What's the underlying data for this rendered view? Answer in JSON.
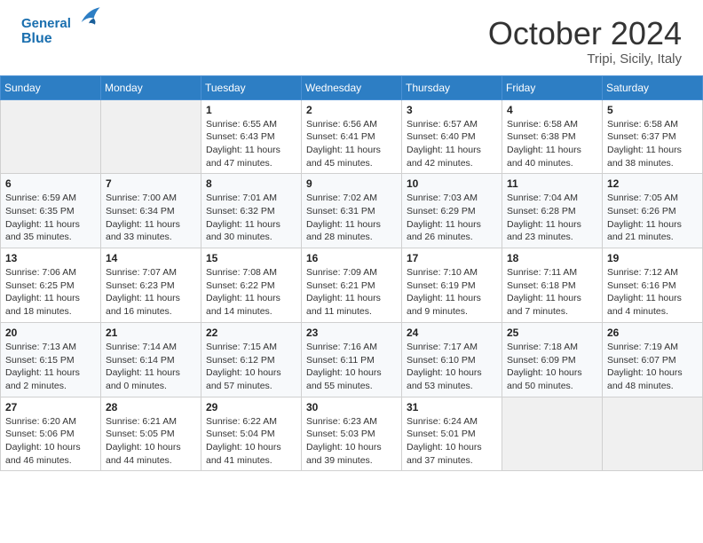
{
  "header": {
    "logo_line1": "General",
    "logo_line2": "Blue",
    "month_title": "October 2024",
    "location": "Tripi, Sicily, Italy"
  },
  "weekdays": [
    "Sunday",
    "Monday",
    "Tuesday",
    "Wednesday",
    "Thursday",
    "Friday",
    "Saturday"
  ],
  "weeks": [
    [
      {
        "day": "",
        "info": ""
      },
      {
        "day": "",
        "info": ""
      },
      {
        "day": "1",
        "info": "Sunrise: 6:55 AM\nSunset: 6:43 PM\nDaylight: 11 hours and 47 minutes."
      },
      {
        "day": "2",
        "info": "Sunrise: 6:56 AM\nSunset: 6:41 PM\nDaylight: 11 hours and 45 minutes."
      },
      {
        "day": "3",
        "info": "Sunrise: 6:57 AM\nSunset: 6:40 PM\nDaylight: 11 hours and 42 minutes."
      },
      {
        "day": "4",
        "info": "Sunrise: 6:58 AM\nSunset: 6:38 PM\nDaylight: 11 hours and 40 minutes."
      },
      {
        "day": "5",
        "info": "Sunrise: 6:58 AM\nSunset: 6:37 PM\nDaylight: 11 hours and 38 minutes."
      }
    ],
    [
      {
        "day": "6",
        "info": "Sunrise: 6:59 AM\nSunset: 6:35 PM\nDaylight: 11 hours and 35 minutes."
      },
      {
        "day": "7",
        "info": "Sunrise: 7:00 AM\nSunset: 6:34 PM\nDaylight: 11 hours and 33 minutes."
      },
      {
        "day": "8",
        "info": "Sunrise: 7:01 AM\nSunset: 6:32 PM\nDaylight: 11 hours and 30 minutes."
      },
      {
        "day": "9",
        "info": "Sunrise: 7:02 AM\nSunset: 6:31 PM\nDaylight: 11 hours and 28 minutes."
      },
      {
        "day": "10",
        "info": "Sunrise: 7:03 AM\nSunset: 6:29 PM\nDaylight: 11 hours and 26 minutes."
      },
      {
        "day": "11",
        "info": "Sunrise: 7:04 AM\nSunset: 6:28 PM\nDaylight: 11 hours and 23 minutes."
      },
      {
        "day": "12",
        "info": "Sunrise: 7:05 AM\nSunset: 6:26 PM\nDaylight: 11 hours and 21 minutes."
      }
    ],
    [
      {
        "day": "13",
        "info": "Sunrise: 7:06 AM\nSunset: 6:25 PM\nDaylight: 11 hours and 18 minutes."
      },
      {
        "day": "14",
        "info": "Sunrise: 7:07 AM\nSunset: 6:23 PM\nDaylight: 11 hours and 16 minutes."
      },
      {
        "day": "15",
        "info": "Sunrise: 7:08 AM\nSunset: 6:22 PM\nDaylight: 11 hours and 14 minutes."
      },
      {
        "day": "16",
        "info": "Sunrise: 7:09 AM\nSunset: 6:21 PM\nDaylight: 11 hours and 11 minutes."
      },
      {
        "day": "17",
        "info": "Sunrise: 7:10 AM\nSunset: 6:19 PM\nDaylight: 11 hours and 9 minutes."
      },
      {
        "day": "18",
        "info": "Sunrise: 7:11 AM\nSunset: 6:18 PM\nDaylight: 11 hours and 7 minutes."
      },
      {
        "day": "19",
        "info": "Sunrise: 7:12 AM\nSunset: 6:16 PM\nDaylight: 11 hours and 4 minutes."
      }
    ],
    [
      {
        "day": "20",
        "info": "Sunrise: 7:13 AM\nSunset: 6:15 PM\nDaylight: 11 hours and 2 minutes."
      },
      {
        "day": "21",
        "info": "Sunrise: 7:14 AM\nSunset: 6:14 PM\nDaylight: 11 hours and 0 minutes."
      },
      {
        "day": "22",
        "info": "Sunrise: 7:15 AM\nSunset: 6:12 PM\nDaylight: 10 hours and 57 minutes."
      },
      {
        "day": "23",
        "info": "Sunrise: 7:16 AM\nSunset: 6:11 PM\nDaylight: 10 hours and 55 minutes."
      },
      {
        "day": "24",
        "info": "Sunrise: 7:17 AM\nSunset: 6:10 PM\nDaylight: 10 hours and 53 minutes."
      },
      {
        "day": "25",
        "info": "Sunrise: 7:18 AM\nSunset: 6:09 PM\nDaylight: 10 hours and 50 minutes."
      },
      {
        "day": "26",
        "info": "Sunrise: 7:19 AM\nSunset: 6:07 PM\nDaylight: 10 hours and 48 minutes."
      }
    ],
    [
      {
        "day": "27",
        "info": "Sunrise: 6:20 AM\nSunset: 5:06 PM\nDaylight: 10 hours and 46 minutes."
      },
      {
        "day": "28",
        "info": "Sunrise: 6:21 AM\nSunset: 5:05 PM\nDaylight: 10 hours and 44 minutes."
      },
      {
        "day": "29",
        "info": "Sunrise: 6:22 AM\nSunset: 5:04 PM\nDaylight: 10 hours and 41 minutes."
      },
      {
        "day": "30",
        "info": "Sunrise: 6:23 AM\nSunset: 5:03 PM\nDaylight: 10 hours and 39 minutes."
      },
      {
        "day": "31",
        "info": "Sunrise: 6:24 AM\nSunset: 5:01 PM\nDaylight: 10 hours and 37 minutes."
      },
      {
        "day": "",
        "info": ""
      },
      {
        "day": "",
        "info": ""
      }
    ]
  ]
}
